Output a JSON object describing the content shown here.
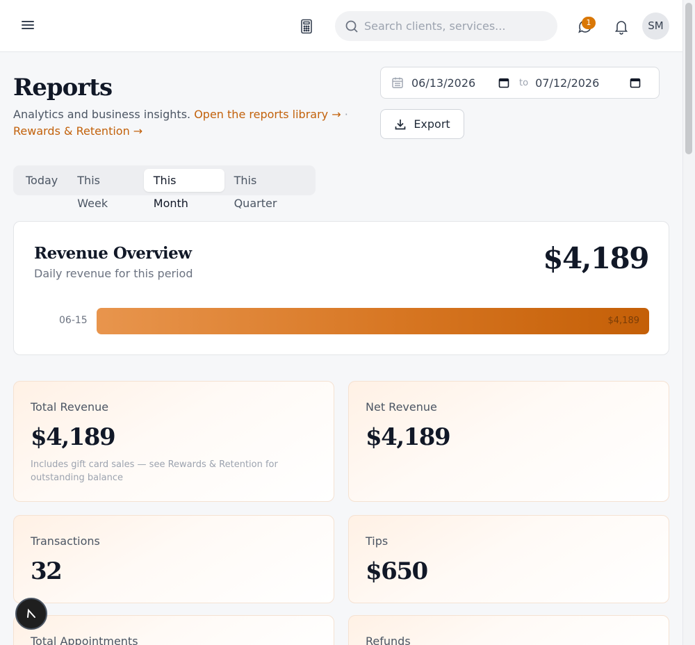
{
  "header": {
    "search_placeholder": "Search clients, services...",
    "message_badge_count": "1",
    "avatar_initials": "SM",
    "icons": [
      "menu-icon",
      "calculator-icon",
      "search-icon",
      "message-icon",
      "bell-icon"
    ]
  },
  "page": {
    "title": "Reports",
    "subtitle": "Analytics and business insights.",
    "reports_library_link": "Open the reports library →",
    "separator": "·",
    "rewards_link": "Rewards & Retention →"
  },
  "date_range": {
    "from": "06/13/2026",
    "to_label": "to",
    "to": "07/12/2026"
  },
  "export_label": "Export",
  "period_tabs": [
    {
      "label": "Today",
      "active": false
    },
    {
      "label": "This Week",
      "active": false
    },
    {
      "label": "This Month",
      "active": true
    },
    {
      "label": "This Quarter",
      "active": false
    }
  ],
  "revenue_overview": {
    "title": "Revenue Overview",
    "subtitle": "Daily revenue for this period",
    "total": "$4,189",
    "bars": [
      {
        "label": "06-15",
        "value_label": "$4,189",
        "fraction": 1.0
      }
    ]
  },
  "stats": [
    {
      "label": "Total Revenue",
      "value": "$4,189",
      "note": "Includes gift card sales — see Rewards & Retention for outstanding balance"
    },
    {
      "label": "Net Revenue",
      "value": "$4,189",
      "note": ""
    },
    {
      "label": "Transactions",
      "value": "32",
      "note": ""
    },
    {
      "label": "Tips",
      "value": "$650",
      "note": ""
    },
    {
      "label": "Total Appointments",
      "value": "",
      "note": ""
    },
    {
      "label": "Refunds",
      "value": "",
      "note": ""
    }
  ],
  "colors": {
    "accent": "#c2610b",
    "bar_start": "#e8954d",
    "bar_end": "#c45f07",
    "badge": "#d97706"
  }
}
